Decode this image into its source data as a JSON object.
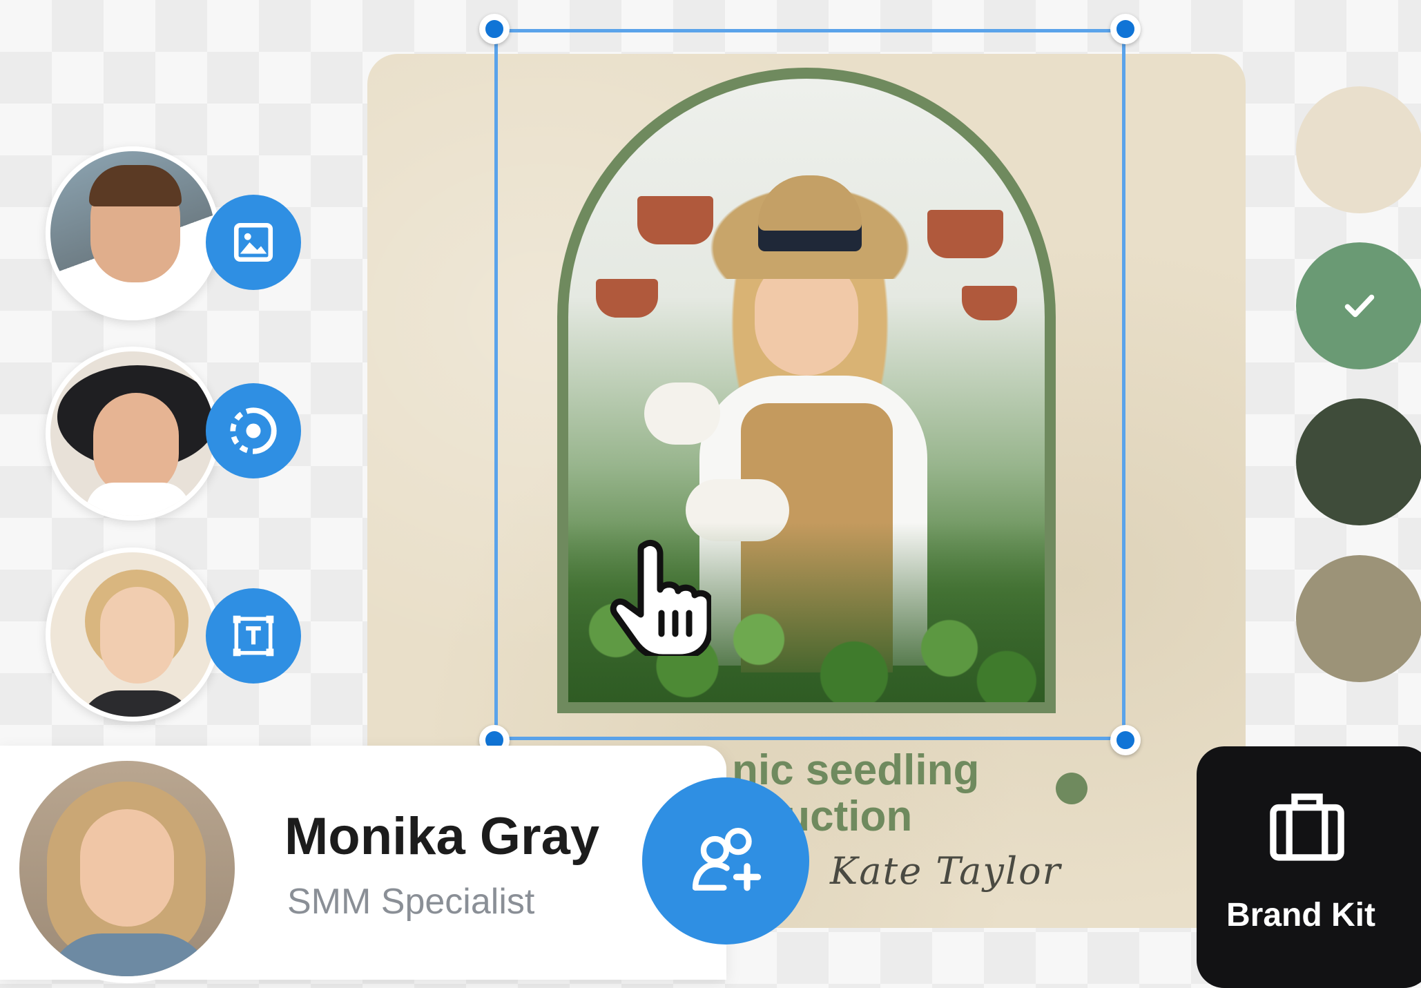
{
  "design": {
    "headline_line1": "nic seedling",
    "headline_line2": "luction",
    "author": "Kate Taylor"
  },
  "collaborators": [
    {
      "role_icon": "image-icon"
    },
    {
      "role_icon": "loading-circle-icon"
    },
    {
      "role_icon": "text-frame-icon"
    }
  ],
  "profile": {
    "name": "Monika Gray",
    "role": "SMM Specialist",
    "action_icon": "add-user-icon"
  },
  "palette": {
    "swatches": [
      "#e9dfcc",
      "#6a9a74",
      "#3f4c3a",
      "#9c9378"
    ],
    "selected_index": 1
  },
  "brand_kit": {
    "label": "Brand Kit",
    "icon": "briefcase-icon"
  },
  "colors": {
    "accent": "#2f8fe3",
    "selection": "#5aa3ea",
    "handle": "#1074d6",
    "card_bg": "#e9dfc9",
    "card_text": "#6f8a5e",
    "brand_kit_bg": "#121214"
  }
}
